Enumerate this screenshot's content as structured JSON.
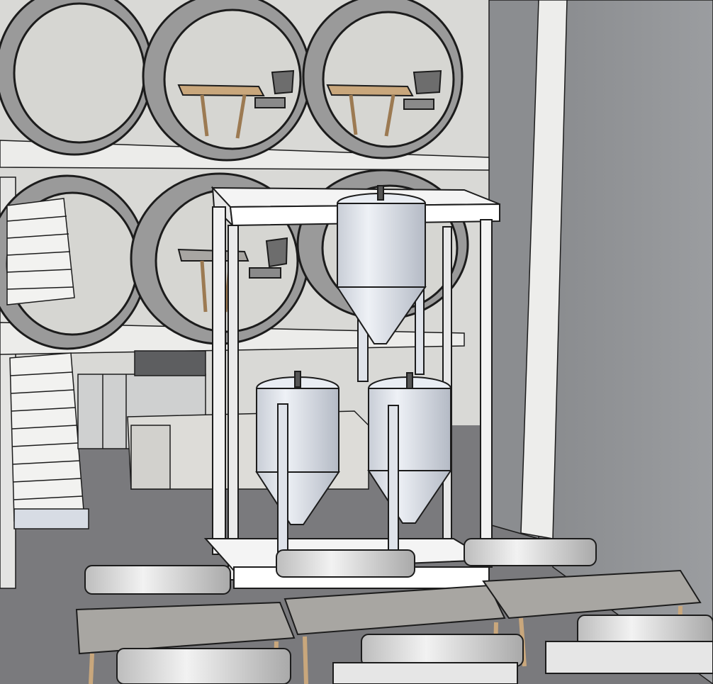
{
  "scene": {
    "colors": {
      "floor": "#7a7a7d",
      "wall_right": "#8f9194",
      "wall_light": "#e8e8e6",
      "pipe_outer": "#9a9a9a",
      "pipe_inner": "#d6d6d2",
      "shelf": "#ececea",
      "wood": "#c9a77c",
      "wood_dark": "#9c7a52",
      "chair": "#6d6d6d",
      "tank": "#d8dde6",
      "tank_shade": "#b9bfca",
      "frame": "#f4f4f4",
      "table_top": "#a8a6a2",
      "bench": "#d9d9d9",
      "outline": "#1c1c1c"
    },
    "icons": [
      "pipe-seat-icon",
      "fermentation-tank-icon",
      "table-icon",
      "bench-icon",
      "chair-icon",
      "staircase-icon"
    ]
  }
}
